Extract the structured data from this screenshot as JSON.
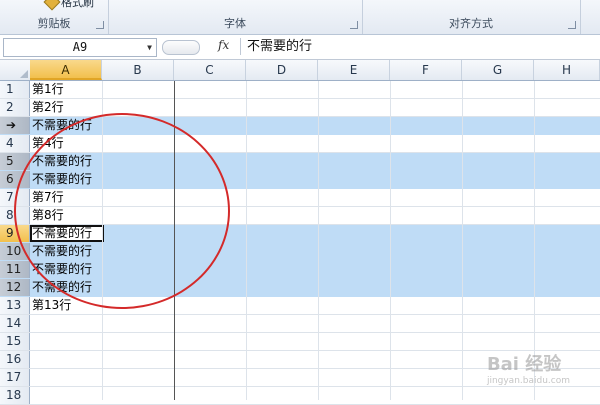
{
  "ribbon": {
    "groups": [
      {
        "label": "剪贴板"
      },
      {
        "label": "字体"
      },
      {
        "label": "对齐方式"
      }
    ],
    "format_painter_label": "格式刷"
  },
  "formula_bar": {
    "name_box": "A9",
    "fx_label": "fx",
    "formula_value": "不需要的行"
  },
  "columns": [
    "A",
    "B",
    "C",
    "D",
    "E",
    "F",
    "G",
    "H"
  ],
  "selected_column": "A",
  "rows": [
    {
      "num": "1",
      "a": "第1行",
      "highlight": false
    },
    {
      "num": "2",
      "a": "第2行",
      "highlight": false
    },
    {
      "num": "",
      "a": "不需要的行",
      "highlight": true,
      "arrow": "➔"
    },
    {
      "num": "4",
      "a": "第4行",
      "highlight": false
    },
    {
      "num": "5",
      "a": "不需要的行",
      "highlight": true
    },
    {
      "num": "6",
      "a": "不需要的行",
      "highlight": true
    },
    {
      "num": "7",
      "a": "第7行",
      "highlight": false
    },
    {
      "num": "8",
      "a": "第8行",
      "highlight": false
    },
    {
      "num": "9",
      "a": "不需要的行",
      "highlight": true,
      "active": true
    },
    {
      "num": "10",
      "a": "不需要的行",
      "highlight": true
    },
    {
      "num": "11",
      "a": "不需要的行",
      "highlight": true
    },
    {
      "num": "12",
      "a": "不需要的行",
      "highlight": true
    },
    {
      "num": "13",
      "a": "第13行",
      "highlight": false
    },
    {
      "num": "14",
      "a": "",
      "highlight": false
    },
    {
      "num": "15",
      "a": "",
      "highlight": false
    },
    {
      "num": "16",
      "a": "",
      "highlight": false
    },
    {
      "num": "17",
      "a": "",
      "highlight": false
    },
    {
      "num": "18",
      "a": "",
      "highlight": false
    }
  ],
  "watermark": {
    "text": "Bai 经验",
    "sub": "jingyan.baidu.com"
  },
  "colors": {
    "highlight": "#bfdcf6",
    "selected_header": "#f2c04d",
    "annotation": "#d42a2a"
  }
}
